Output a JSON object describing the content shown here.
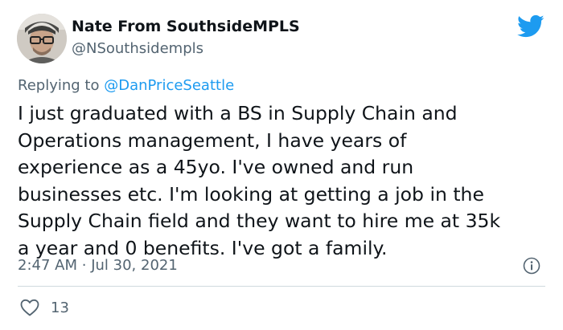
{
  "author": {
    "display_name": "Nate From SouthsideMPLS",
    "handle": "@NSouthsidempls",
    "avatar_icon": "user-avatar"
  },
  "platform_icon": "twitter-bird-icon",
  "brand_color": "#1d9bf0",
  "reply": {
    "prefix": "Replying to",
    "target": "@DanPriceSeattle"
  },
  "tweet": {
    "lines": [
      "I just graduated with a BS in Supply Chain and",
      "Operations management, I have years of",
      "experience as a 45yo. I've owned and run",
      "businesses etc. I'm looking at getting a job in the",
      "Supply Chain field and they want to hire me at 35k",
      "a year and 0 benefits. I've got a family."
    ]
  },
  "meta": {
    "time": "2:47 AM",
    "separator": "·",
    "date": "Jul 30, 2021"
  },
  "actions": {
    "like_icon": "heart-icon",
    "like_count": "13",
    "info_icon": "info-icon"
  }
}
